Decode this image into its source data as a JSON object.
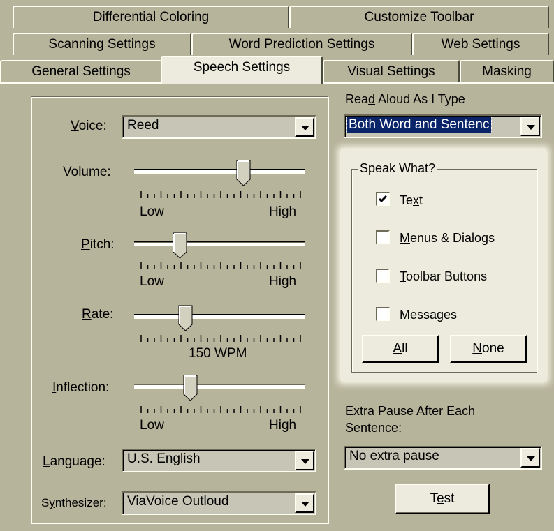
{
  "tabs": {
    "row1": [
      "Differential Coloring",
      "Customize Toolbar"
    ],
    "row2": [
      "Scanning Settings",
      "Word Prediction Settings",
      "Web Settings"
    ],
    "row3": [
      "General Settings",
      "Speech Settings",
      "Visual Settings",
      "Masking"
    ],
    "active": "Speech Settings"
  },
  "voice": {
    "label": "Voice:",
    "value": "Reed"
  },
  "volume": {
    "label": "Volume:",
    "low": "Low",
    "high": "High",
    "level": 0.64
  },
  "pitch": {
    "label": "Pitch:",
    "low": "Low",
    "high": "High",
    "level": 0.27
  },
  "rate": {
    "label": "Rate:",
    "readout": "150 WPM",
    "level": 0.3
  },
  "inflection": {
    "label": "Inflection:",
    "low": "Low",
    "high": "High",
    "level": 0.33
  },
  "language": {
    "label": "Language:",
    "value": "U.S. English"
  },
  "synthesizer": {
    "label": "Synthesizer:",
    "value": "ViaVoice Outloud"
  },
  "read_aloud": {
    "label": "Read Aloud As I Type",
    "value": "Both Word and Sentenc"
  },
  "speak_what": {
    "title": "Speak What?",
    "options": [
      {
        "label": "Text",
        "checked": true
      },
      {
        "label": "Menus & Dialogs",
        "checked": false
      },
      {
        "label": "Toolbar Buttons",
        "checked": false
      },
      {
        "label": "Messages",
        "checked": false
      }
    ],
    "all_button": "All",
    "none_button": "None"
  },
  "extra_pause": {
    "label_line1": "Extra Pause After Each",
    "label_line2": "Sentence:",
    "value": "No extra pause"
  },
  "test_button": "Test",
  "colors": {
    "face": "#b7b49c",
    "highlight": "#ecebdd",
    "selection": "#0a246a"
  }
}
